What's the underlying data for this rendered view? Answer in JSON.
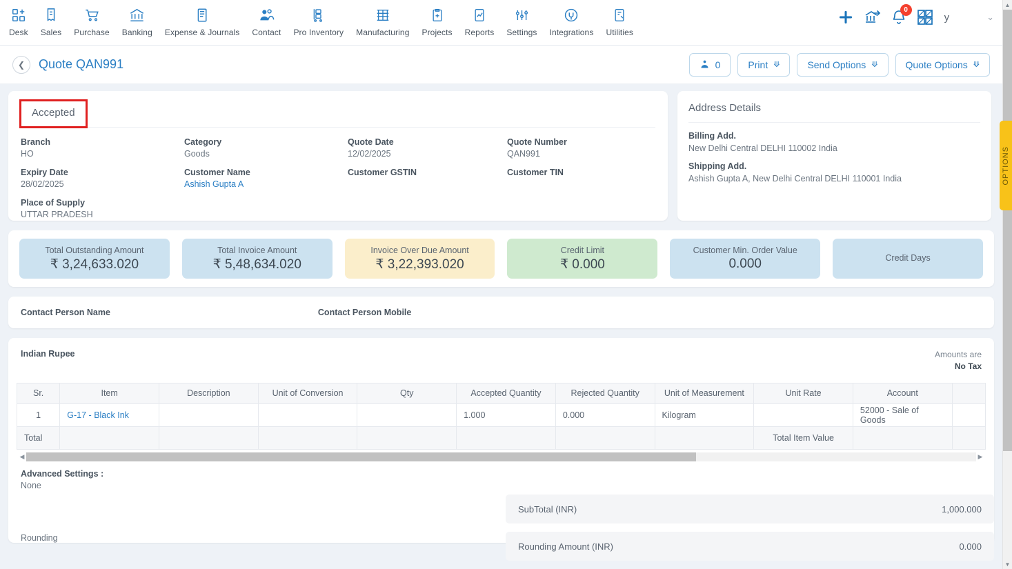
{
  "nav": {
    "items": [
      {
        "label": "Desk",
        "icon": "desk-icon"
      },
      {
        "label": "Sales",
        "icon": "sales-receipt-icon"
      },
      {
        "label": "Purchase",
        "icon": "purchase-cart-icon"
      },
      {
        "label": "Banking",
        "icon": "bank-icon"
      },
      {
        "label": "Expense & Journals",
        "icon": "journal-icon"
      },
      {
        "label": "Contact",
        "icon": "contact-people-icon"
      },
      {
        "label": "Pro Inventory",
        "icon": "inventory-trolley-icon"
      },
      {
        "label": "Manufacturing",
        "icon": "manufacturing-icon"
      },
      {
        "label": "Projects",
        "icon": "projects-clipboard-icon"
      },
      {
        "label": "Reports",
        "icon": "reports-chart-icon"
      },
      {
        "label": "Settings",
        "icon": "settings-sliders-icon"
      },
      {
        "label": "Integrations",
        "icon": "integrations-plug-icon"
      },
      {
        "label": "Utilities",
        "icon": "utilities-icon"
      }
    ],
    "right": {
      "add_icon": "plus-icon",
      "bank_transfer_icon": "bank-transfer-icon",
      "notification_icon": "bell-icon",
      "notification_count": "0",
      "apps_icon": "grid-apps-icon",
      "user_initial": "y",
      "expand_icon": "chevron-down-icon"
    }
  },
  "subheader": {
    "back_icon": "chevron-left-icon",
    "title": "Quote QAN991",
    "actions": {
      "attachment_icon": "person-upload-icon",
      "attachment_count": "0",
      "print_label": "Print",
      "send_options_label": "Send Options",
      "quote_options_label": "Quote Options",
      "chevron": "∨"
    }
  },
  "details": {
    "status": "Accepted",
    "fields": [
      {
        "label": "Branch",
        "value": "HO",
        "link": false
      },
      {
        "label": "Category",
        "value": "Goods",
        "link": false
      },
      {
        "label": "Quote Date",
        "value": "12/02/2025",
        "link": false
      },
      {
        "label": "Quote Number",
        "value": "QAN991",
        "link": false
      },
      {
        "label": "Expiry Date",
        "value": "28/02/2025",
        "link": false
      },
      {
        "label": "Customer Name",
        "value": "Ashish Gupta A",
        "link": true
      },
      {
        "label": "Customer GSTIN",
        "value": "",
        "link": false
      },
      {
        "label": "Customer TIN",
        "value": "",
        "link": false
      },
      {
        "label": "Place of Supply",
        "value": "UTTAR PRADESH",
        "link": false
      }
    ]
  },
  "address": {
    "heading": "Address Details",
    "billing_label": "Billing Add.",
    "billing_value": "New Delhi Central DELHI 110002 India",
    "shipping_label": "Shipping Add.",
    "shipping_value": "Ashish Gupta A, New Delhi Central DELHI 110001 India"
  },
  "options_tab": {
    "label": "OPTIONS",
    "color": "#f8c219"
  },
  "kpis": [
    {
      "label": "Total Outstanding Amount",
      "value": "₹ 3,24,633.020",
      "color": "#cce2f0"
    },
    {
      "label": "Total Invoice Amount",
      "value": "₹ 5,48,634.020",
      "color": "#cce2f0"
    },
    {
      "label": "Invoice Over Due Amount",
      "value": "₹ 3,22,393.020",
      "color": "#fbeecb"
    },
    {
      "label": "Credit Limit",
      "value": "₹ 0.000",
      "color": "#cfeacf"
    },
    {
      "label": "Customer Min. Order Value",
      "value": "0.000",
      "color": "#cce2f0"
    },
    {
      "label": "Credit Days",
      "value": "",
      "color": "#cce2f0"
    }
  ],
  "contact": {
    "person_name_label": "Contact Person Name",
    "person_mobile_label": "Contact Person Mobile"
  },
  "items_section": {
    "currency": "Indian Rupee",
    "amounts_are_label": "Amounts are",
    "amounts_are_value": "No Tax",
    "columns": [
      "Sr.",
      "Item",
      "Description",
      "Unit of Conversion",
      "Qty",
      "Accepted Quantity",
      "Rejected Quantity",
      "Unit of Measurement",
      "Unit Rate",
      "Account",
      ""
    ],
    "rows": [
      {
        "sr": "1",
        "item": "G-17 - Black Ink",
        "description": "",
        "unit_of_conversion": "",
        "qty": "",
        "accepted_quantity": "1.000",
        "rejected_quantity": "0.000",
        "unit_of_measurement": "Kilogram",
        "unit_rate": "",
        "account": "52000 - Sale of Goods",
        "extra": ""
      }
    ],
    "total_row": {
      "label": "Total",
      "total_item_value_label": "Total Item Value"
    },
    "scroll_left_arrow": "◀",
    "scroll_right_arrow": "▶"
  },
  "advanced": {
    "label": "Advanced Settings :",
    "value": "None",
    "rounding_label": "Rounding"
  },
  "totals": [
    {
      "label": "SubTotal (INR)",
      "value": "1,000.000"
    },
    {
      "label": "Rounding Amount (INR)",
      "value": "0.000"
    }
  ]
}
